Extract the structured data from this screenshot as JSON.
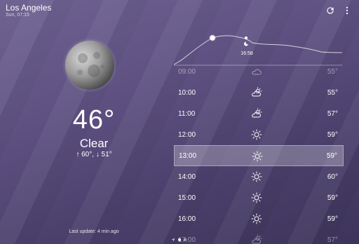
{
  "location": {
    "city": "Los Angeles",
    "datetime": "Sun, 07:15"
  },
  "toolbar": {
    "refresh_icon": "refresh-icon",
    "more_icon": "more-vertical-icon"
  },
  "current": {
    "temperature": "46°",
    "condition": "Clear",
    "high_low": "↑ 60°, ↓ 51°",
    "icon": "moon-icon"
  },
  "last_update": "Last update: 4 min ago",
  "graph": {
    "marker_label": "16:58"
  },
  "pager": {
    "pages": 2,
    "active": 0
  },
  "hours": [
    {
      "time": "09:00",
      "icon": "cloud-icon",
      "temp": "55°"
    },
    {
      "time": "10:00",
      "icon": "partly-cloudy-icon",
      "temp": "55°"
    },
    {
      "time": "11:00",
      "icon": "partly-cloudy-icon",
      "temp": "57°"
    },
    {
      "time": "12:00",
      "icon": "sun-icon",
      "temp": "59°"
    },
    {
      "time": "13:00",
      "icon": "sun-icon",
      "temp": "59°",
      "selected": true
    },
    {
      "time": "14:00",
      "icon": "sun-icon",
      "temp": "60°"
    },
    {
      "time": "15:00",
      "icon": "sun-icon",
      "temp": "59°"
    },
    {
      "time": "16:00",
      "icon": "sun-icon",
      "temp": "59°"
    },
    {
      "time": "17:00",
      "icon": "partly-cloudy-icon",
      "temp": "57°"
    }
  ],
  "colors": {
    "background": "#5f5283",
    "text": "#ffffff",
    "selected_row": "rgba(255,255,255,0.26)"
  }
}
